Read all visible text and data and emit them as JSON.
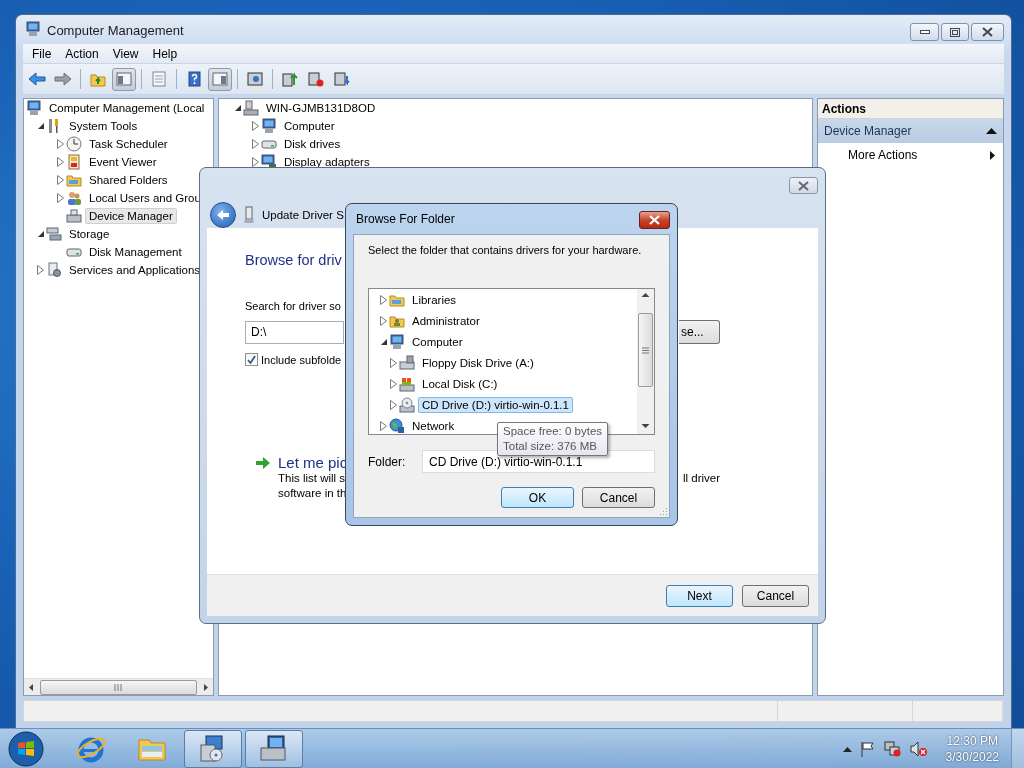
{
  "main_window": {
    "title": "Computer Management",
    "menu": [
      "File",
      "Action",
      "View",
      "Help"
    ],
    "toolbar": [
      [
        {
          "kind": "back",
          "pressed": false
        },
        {
          "kind": "forward",
          "pressed": false
        }
      ],
      [
        {
          "kind": "up",
          "pressed": false
        },
        {
          "kind": "tree",
          "pressed": true
        }
      ],
      [
        {
          "kind": "sheet",
          "pressed": false
        }
      ],
      [
        {
          "kind": "help",
          "pressed": false
        },
        {
          "kind": "pane",
          "pressed": true
        }
      ],
      [
        {
          "kind": "scan",
          "pressed": false
        }
      ],
      [
        {
          "kind": "update",
          "pressed": false
        },
        {
          "kind": "disable",
          "pressed": false
        },
        {
          "kind": "uninstall",
          "pressed": false
        }
      ]
    ],
    "console_tree": [
      {
        "label": "Computer Management (Local",
        "kind": "management",
        "expandable": false,
        "selected": false,
        "children": [
          {
            "label": "System Tools",
            "kind": "tools",
            "expandable": true,
            "expanded": true,
            "selected": false,
            "children": [
              {
                "label": "Task Scheduler",
                "kind": "scheduler",
                "expandable": true,
                "expanded": false,
                "selected": false
              },
              {
                "label": "Event Viewer",
                "kind": "events",
                "expandable": true,
                "expanded": false,
                "selected": false
              },
              {
                "label": "Shared Folders",
                "kind": "shared",
                "expandable": true,
                "expanded": false,
                "selected": false
              },
              {
                "label": "Local Users and Grou",
                "kind": "users",
                "expandable": true,
                "expanded": false,
                "selected": false
              },
              {
                "label": "Device Manager",
                "kind": "devices",
                "expandable": false,
                "selected": true
              }
            ]
          },
          {
            "label": "Storage",
            "kind": "storage",
            "expandable": true,
            "expanded": true,
            "selected": false,
            "children": [
              {
                "label": "Disk Management",
                "kind": "disk",
                "expandable": false,
                "selected": false
              }
            ]
          },
          {
            "label": "Services and Applications",
            "kind": "services",
            "expandable": true,
            "expanded": false,
            "selected": false
          }
        ]
      }
    ],
    "device_tree": [
      {
        "label": "WIN-GJMB131D8OD",
        "kind": "host",
        "expandable": true,
        "expanded": true,
        "selected": false,
        "children": [
          {
            "label": "Computer",
            "kind": "computer",
            "expandable": true,
            "expanded": false,
            "selected": false
          },
          {
            "label": "Disk drives",
            "kind": "drives",
            "expandable": true,
            "expanded": false,
            "selected": false
          },
          {
            "label": "Display adapters",
            "kind": "display",
            "expandable": true,
            "expanded": false,
            "selected": false
          }
        ]
      }
    ],
    "actions": {
      "title": "Actions",
      "section": "Device Manager",
      "items": [
        "More Actions"
      ]
    }
  },
  "update_driver": {
    "title": "Update Driver S",
    "heading": "Browse for driv",
    "search_label": "Search for driver so",
    "path": "D:\\",
    "browse_button": "se...",
    "include_subfolders": {
      "label": "Include subfolde",
      "checked": true
    },
    "pick": {
      "title": "Let me pic",
      "line_1": "This list will s",
      "line_1_end": "ll driver",
      "line_2": "software in th"
    },
    "buttons": [
      "Next",
      "Cancel"
    ]
  },
  "browse_dialog": {
    "title": "Browse For Folder",
    "instruction": "Select the folder that contains drivers for your hardware.",
    "tree": [
      {
        "label": "Libraries",
        "kind": "libraries",
        "expandable": true,
        "expanded": false,
        "selected": false
      },
      {
        "label": "Administrator",
        "kind": "userfolder",
        "expandable": true,
        "expanded": false,
        "selected": false
      },
      {
        "label": "Computer",
        "kind": "mycomputer",
        "expandable": true,
        "expanded": true,
        "selected": false,
        "children": [
          {
            "label": "Floppy Disk Drive (A:)",
            "kind": "floppy",
            "expandable": true,
            "expanded": false,
            "selected": false
          },
          {
            "label": "Local Disk (C:)",
            "kind": "harddisk",
            "expandable": true,
            "expanded": false,
            "selected": false
          },
          {
            "label": "CD Drive (D:) virtio-win-0.1.1",
            "kind": "cd",
            "expandable": true,
            "expanded": false,
            "selected": true
          }
        ]
      },
      {
        "label": "Network",
        "kind": "network",
        "expandable": true,
        "expanded": false,
        "selected": false
      }
    ],
    "tooltip": [
      "Space free: 0 bytes",
      "Total size: 376 MB"
    ],
    "folder_label": "Folder:",
    "folder_value": "CD Drive (D:) virtio-win-0.1.1",
    "buttons": [
      "OK",
      "Cancel"
    ]
  },
  "taskbar": {
    "apps": [
      {
        "kind": "ie",
        "active": false
      },
      {
        "kind": "explorer",
        "active": false
      },
      {
        "kind": "setup",
        "active": true
      },
      {
        "kind": "manager",
        "active": true
      }
    ],
    "clock": {
      "time": "12:30 PM",
      "date": "3/30/2022"
    }
  }
}
